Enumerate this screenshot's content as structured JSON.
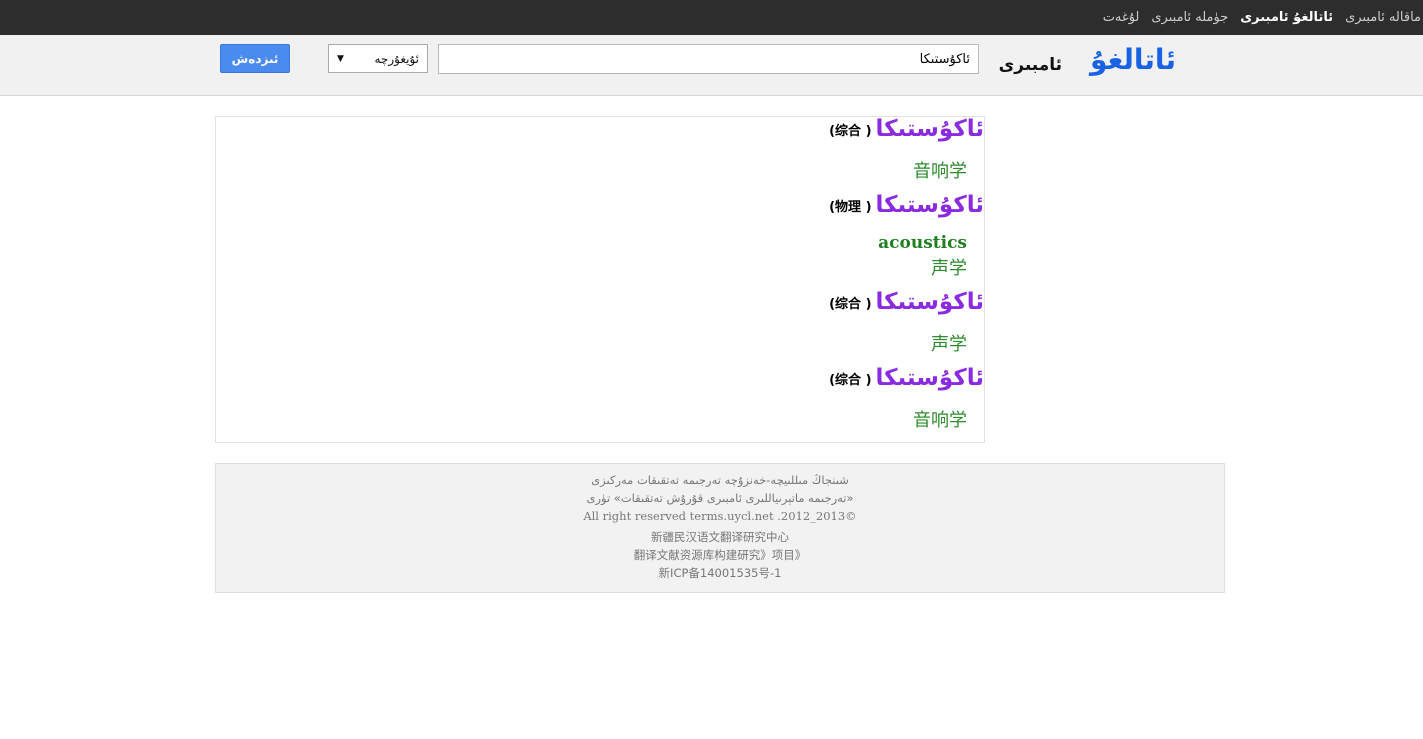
{
  "topnav": {
    "links": [
      {
        "label": "لۇغەت",
        "active": false
      },
      {
        "label": "جۈملە ئامبىرى",
        "active": false
      },
      {
        "label": "ئاتالغۇ ئامبىرى",
        "active": true
      },
      {
        "label": "ماقالە ئامبىرى",
        "active": false
      }
    ]
  },
  "header": {
    "logo": "ئاتالغۇ",
    "logo_sub": "ئامبىرى",
    "search_value": "ئاكۇستىكا",
    "language_selected": "ئۇيغۇرچە",
    "search_button": "ئىزدەش"
  },
  "results": [
    {
      "word": "ئاكۇستىكا",
      "tag": "( 综合)",
      "lines": [
        "音响学"
      ]
    },
    {
      "word": "ئاكۇستىكا",
      "tag": "( 物理)",
      "english": "acoustics",
      "lines": [
        "声学"
      ]
    },
    {
      "word": "ئاكۇستىكا",
      "tag": "( 综合)",
      "lines": [
        "声学"
      ]
    },
    {
      "word": "ئاكۇستىكا",
      "tag": "( 综合)",
      "lines": [
        "音响学"
      ]
    }
  ],
  "footer": {
    "lines": [
      "شىنجاڭ مىللىيچە-خەنزۇچە تەرجىمە تەتقىقات مەركىزى",
      "«تەرجىمە ماتېرىياللىرى ئامبىرى قۇرۇش تەتقىقات» تۈرى",
      "All right reserved terms.uycl.net .2012_2013©",
      "新疆民汉语文翻译研究中心",
      "翻译文献资源库构建研究》项目》",
      "新ICP备14001535号-1"
    ]
  },
  "colors": {
    "topnav_bg": "#2d2d2d",
    "logo": "#1a62e5",
    "word": "#8a2be2",
    "translation": "#2e8b2e",
    "button": "#4a8bf0"
  }
}
